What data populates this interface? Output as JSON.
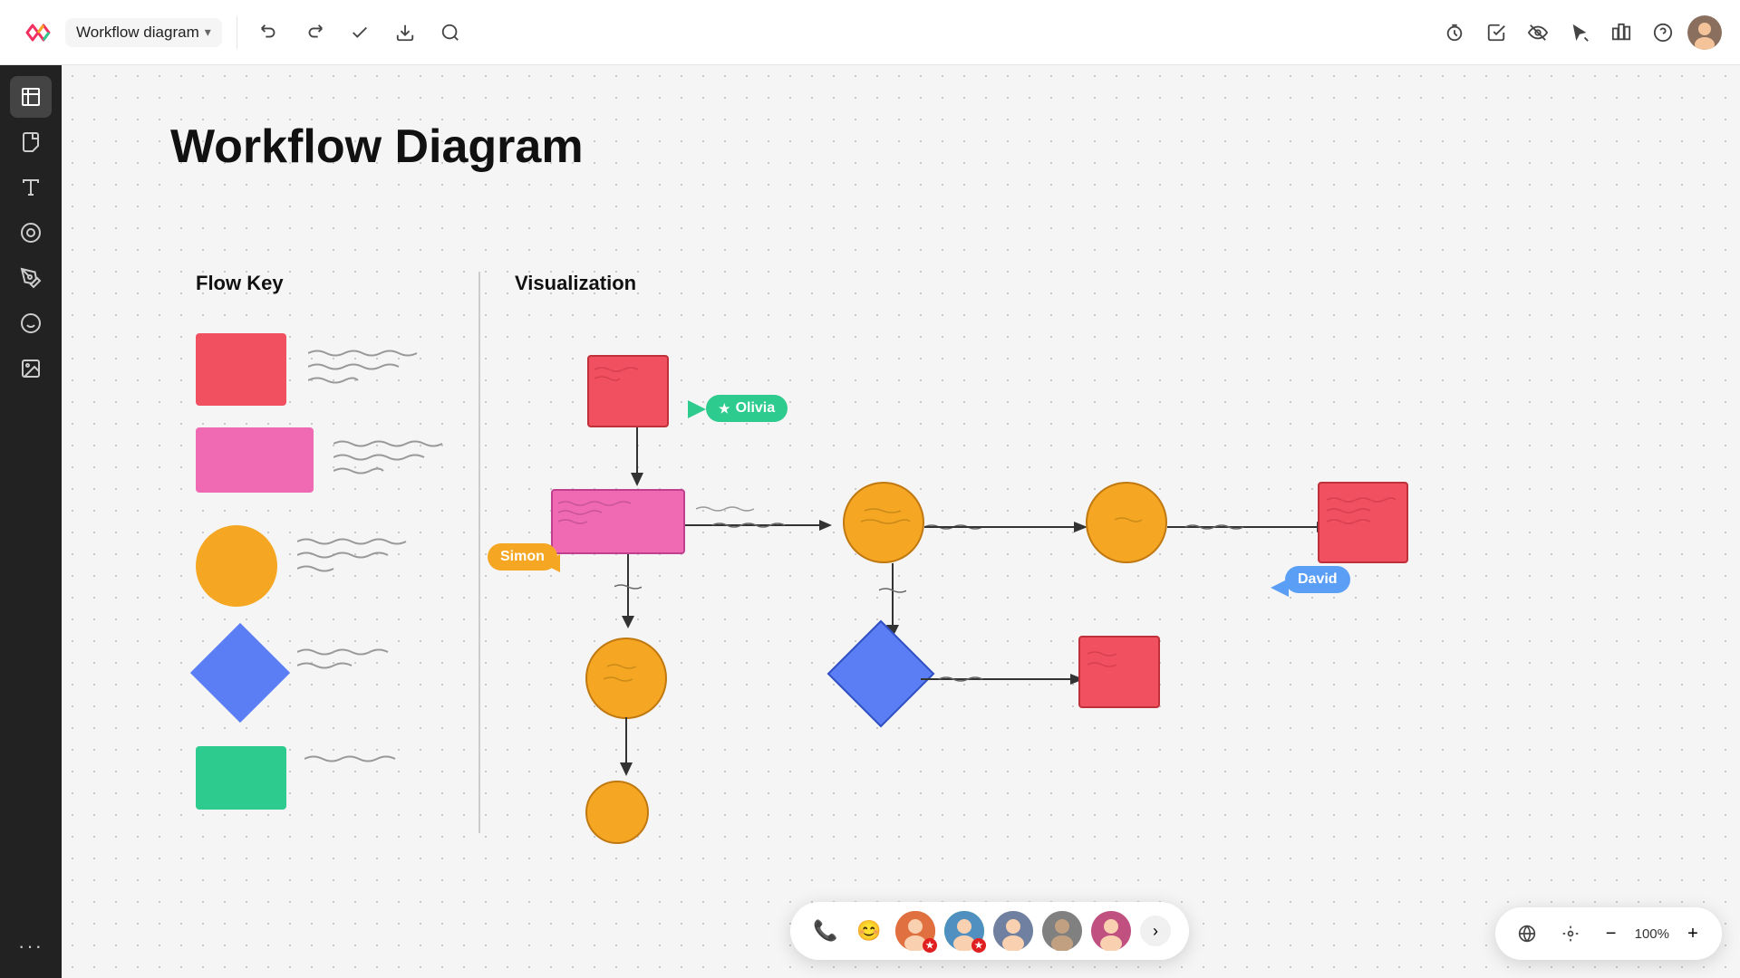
{
  "app": {
    "logo_text": "miro",
    "title": "Workflow diagram",
    "title_dropdown_aria": "Diagram title dropdown"
  },
  "toolbar": {
    "undo_label": "Undo",
    "redo_label": "Redo",
    "save_label": "Save",
    "download_label": "Download",
    "search_label": "Search"
  },
  "toolbar_right": {
    "timer_label": "Timer",
    "check_label": "Check",
    "view_label": "View",
    "cursor_label": "Cursor",
    "briefcase_label": "Apps",
    "help_label": "Help",
    "avatar_label": "User profile"
  },
  "sidebar": {
    "items": [
      {
        "id": "frames",
        "icon": "⊞",
        "label": "Frames"
      },
      {
        "id": "sticky",
        "icon": "🗒",
        "label": "Sticky Notes"
      },
      {
        "id": "text",
        "icon": "T",
        "label": "Text"
      },
      {
        "id": "shapes",
        "icon": "◉",
        "label": "Shapes"
      },
      {
        "id": "pen",
        "icon": "✏",
        "label": "Pen"
      },
      {
        "id": "sticker",
        "icon": "🦄",
        "label": "Stickers"
      },
      {
        "id": "image",
        "icon": "🖼",
        "label": "Image"
      },
      {
        "id": "more",
        "icon": "•••",
        "label": "More"
      }
    ]
  },
  "canvas": {
    "page_title": "Workflow Diagram",
    "flow_key_heading": "Flow Key",
    "visualization_heading": "Visualization"
  },
  "users": [
    {
      "name": "Olivia",
      "color": "#2ecb8e"
    },
    {
      "name": "Simon",
      "color": "#f5a623"
    },
    {
      "name": "David",
      "color": "#5b9ef5"
    }
  ],
  "bottom_bar": {
    "phone_icon": "📞",
    "emoji_icon": "😊",
    "more_label": "›",
    "avatars": [
      {
        "color": "#e07040",
        "badge_color": "#e02020",
        "badge_icon": "★"
      },
      {
        "color": "#4ab060",
        "badge_color": "#e02020",
        "badge_icon": "★"
      },
      {
        "color": "#5080d0",
        "badge_color": null
      },
      {
        "color": "#707070",
        "badge_color": null
      },
      {
        "color": "#c05080",
        "badge_color": null
      }
    ]
  },
  "bottom_right": {
    "zoom_out_label": "−",
    "zoom_level": "100%",
    "zoom_in_label": "+"
  }
}
